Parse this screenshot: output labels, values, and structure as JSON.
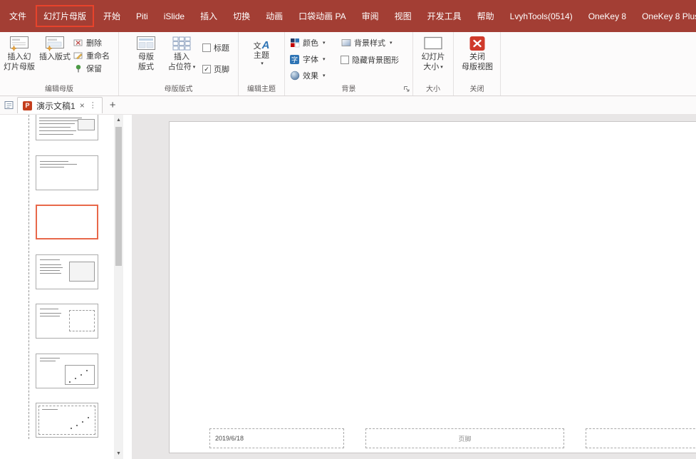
{
  "colors": {
    "titlebar": "#A33E34",
    "accent": "#E8432B",
    "thumb_selection": "#E8684A",
    "canvas": "#E8E6E6",
    "close_button_red": "#CF3A2B"
  },
  "menubar": {
    "tabs": [
      {
        "label": "文件"
      },
      {
        "label": "幻灯片母版",
        "active": true
      },
      {
        "label": "开始"
      },
      {
        "label": "Piti"
      },
      {
        "label": "iSlide"
      },
      {
        "label": "插入"
      },
      {
        "label": "切换"
      },
      {
        "label": "动画"
      },
      {
        "label": "口袋动画 PA"
      },
      {
        "label": "审阅"
      },
      {
        "label": "视图"
      },
      {
        "label": "开发工具"
      },
      {
        "label": "帮助"
      },
      {
        "label": "LvyhTools(0514)"
      },
      {
        "label": "OneKey 8"
      },
      {
        "label": "OneKey 8 Plus"
      }
    ]
  },
  "ribbon": {
    "edit_master": {
      "label": "编辑母版",
      "insert_master_l1": "插入幻",
      "insert_master_l2": "灯片母版",
      "insert_layout": "插入版式",
      "delete": "删除",
      "rename": "重命名",
      "preserve": "保留"
    },
    "master_layout": {
      "label": "母版版式",
      "master_layout_l1": "母版",
      "master_layout_l2": "版式",
      "insert_placeholder_l1": "插入",
      "insert_placeholder_l2": "占位符",
      "title": "标题",
      "title_checked": false,
      "footer": "页脚",
      "footer_checked": true
    },
    "edit_theme": {
      "label": "编辑主题",
      "themes": "主题"
    },
    "background": {
      "label": "背景",
      "colors": "颜色",
      "fonts": "字体",
      "effects": "效果",
      "styles": "背景样式",
      "hide_graphics": "隐藏背景图形",
      "hide_graphics_checked": false
    },
    "size": {
      "label": "大小",
      "slide_size_l1": "幻灯片",
      "slide_size_l2": "大小"
    },
    "close": {
      "label": "关闭",
      "close_l1": "关闭",
      "close_l2": "母版视图"
    }
  },
  "tabstrip": {
    "document_tab": "演示文稿1"
  },
  "thumbnail_panel": {
    "slide_count": 7,
    "selected_slide": 3
  },
  "slide": {
    "date_placeholder": "2019/6/18",
    "footer_placeholder": "页脚",
    "page_number_placeholder": ""
  },
  "icons": {
    "ppt_logo": "P",
    "tab_close": "×",
    "tab_more": "⋮",
    "new_tab": "+",
    "scroll_up": "▲",
    "scroll_down": "▼",
    "dropdown_arrow": "▾",
    "checkbox_check": "✓",
    "themes_zh": "文",
    "themes_a": "A",
    "fonts_glyph": "字"
  }
}
